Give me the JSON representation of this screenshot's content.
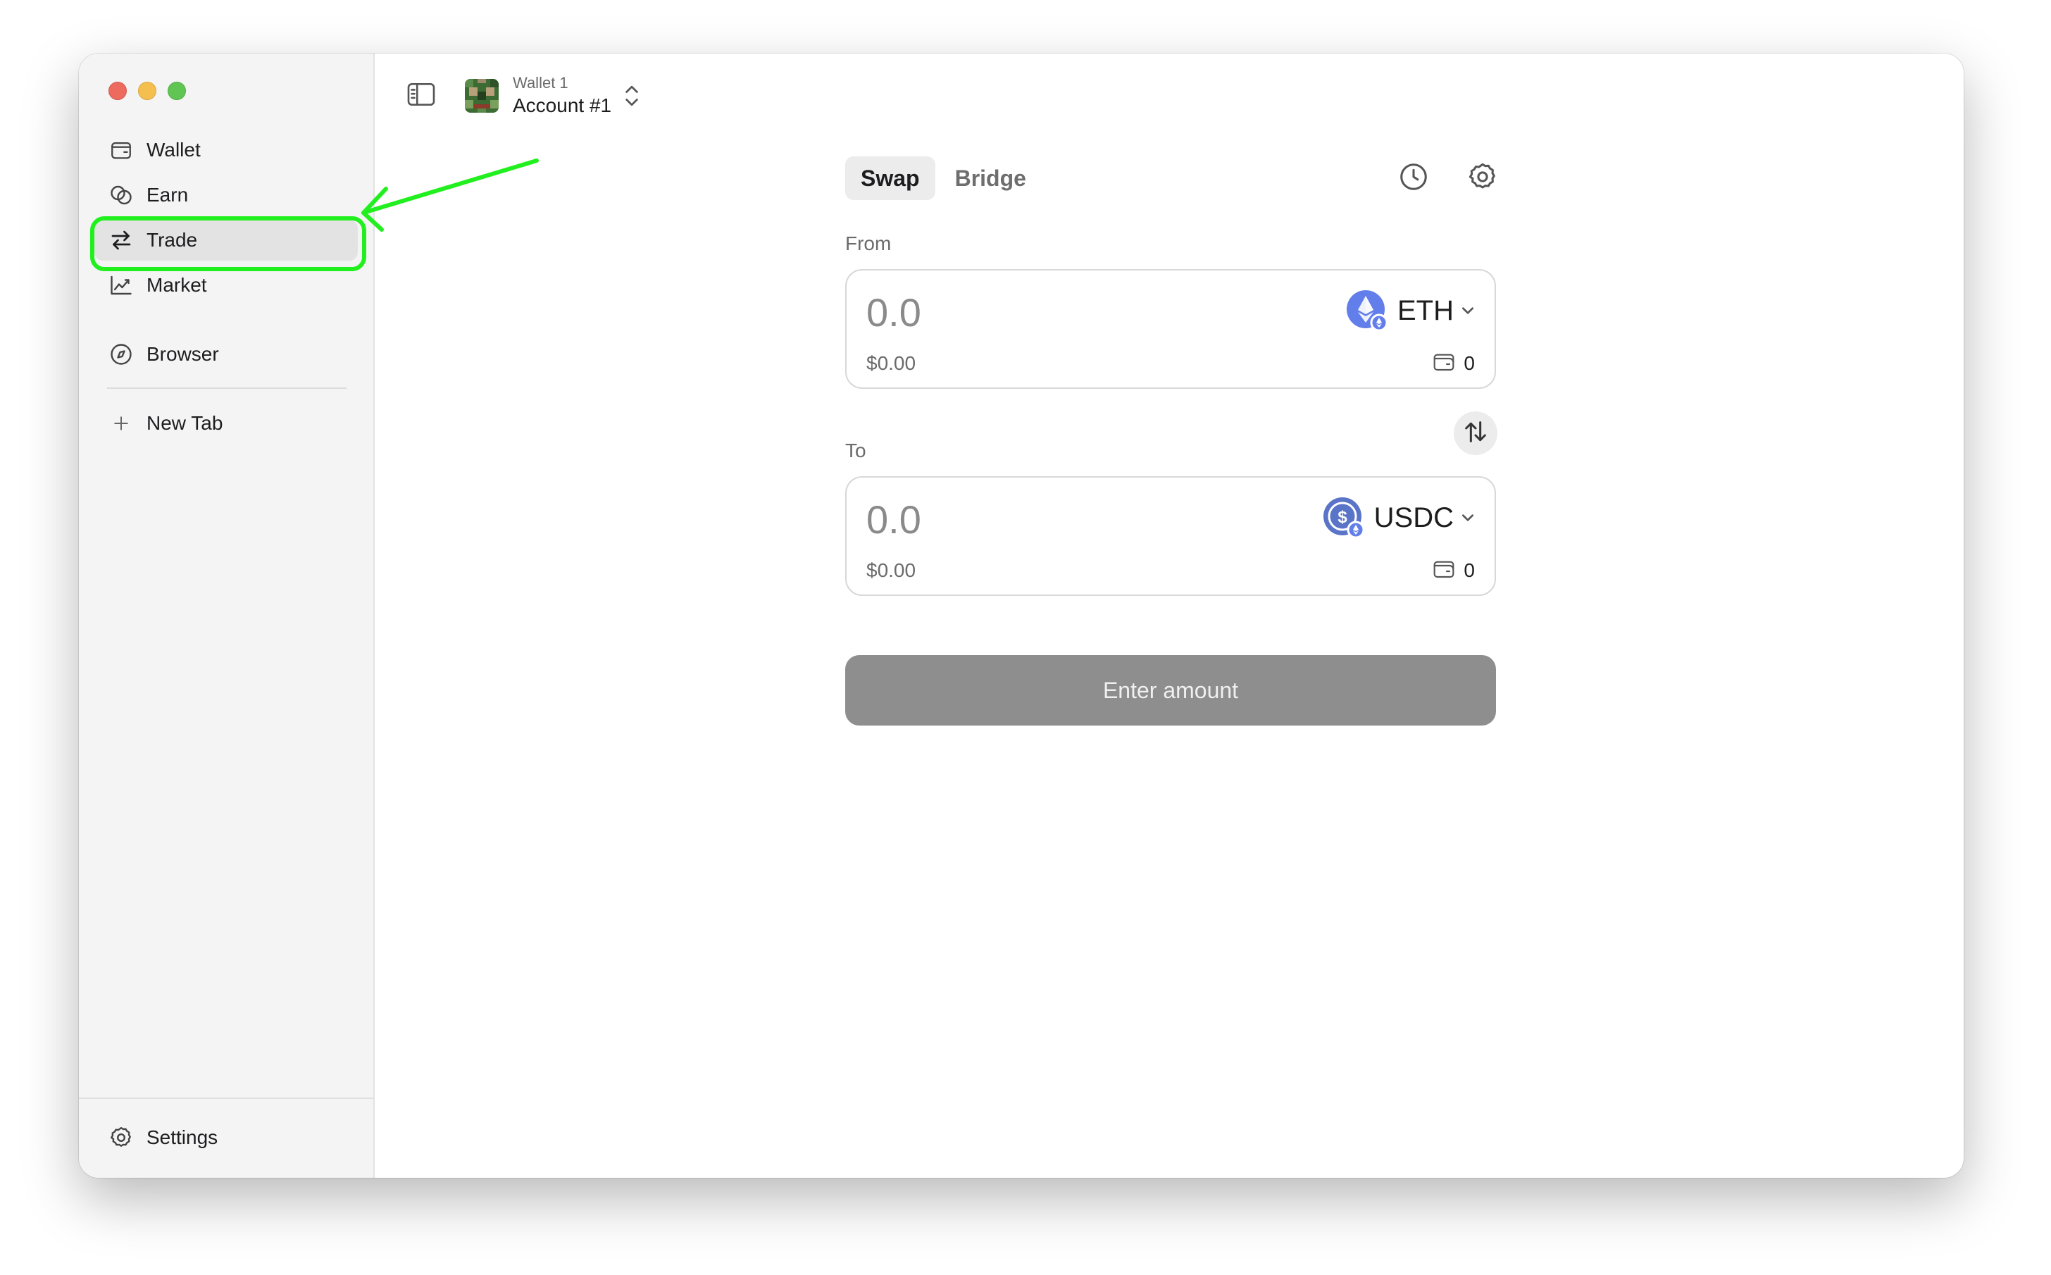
{
  "sidebar": {
    "items": [
      {
        "label": "Wallet",
        "icon": "wallet-icon"
      },
      {
        "label": "Earn",
        "icon": "earn-icon"
      },
      {
        "label": "Trade",
        "icon": "trade-icon",
        "active": true
      },
      {
        "label": "Market",
        "icon": "chart-icon"
      },
      {
        "label": "Browser",
        "icon": "compass-icon"
      },
      {
        "label": "New Tab",
        "icon": "plus-icon"
      }
    ],
    "settings_label": "Settings"
  },
  "header": {
    "wallet_name": "Wallet 1",
    "account_name": "Account #1"
  },
  "trade": {
    "tabs": [
      {
        "label": "Swap",
        "active": true
      },
      {
        "label": "Bridge",
        "active": false
      }
    ],
    "from": {
      "label": "From",
      "placeholder": "0.0",
      "usd_value": "$0.00",
      "token": "ETH",
      "balance": "0"
    },
    "to": {
      "label": "To",
      "placeholder": "0.0",
      "usd_value": "$0.00",
      "token": "USDC",
      "balance": "0"
    },
    "submit_label": "Enter amount"
  },
  "colors": {
    "highlight": "#22f01e",
    "eth": "#627eea",
    "usdc": "#2775ca",
    "button_disabled": "#8e8e8e"
  }
}
